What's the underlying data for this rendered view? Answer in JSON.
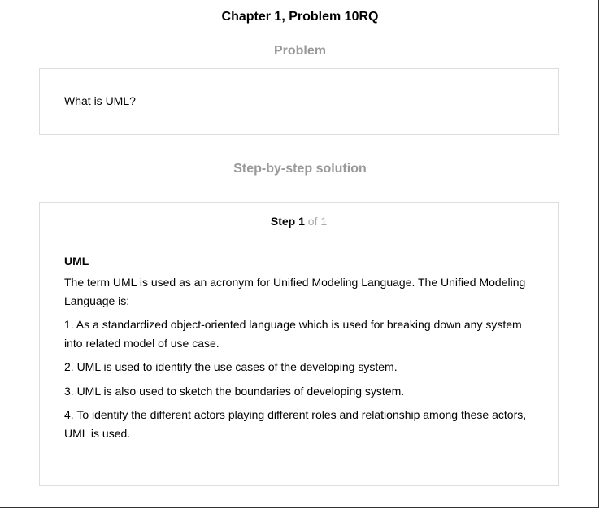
{
  "header": {
    "chapter_title": "Chapter 1, Problem 10RQ"
  },
  "problem": {
    "heading": "Problem",
    "text": "What is UML?"
  },
  "solution": {
    "heading": "Step-by-step solution",
    "step": {
      "label": "Step",
      "number": "1",
      "of_total": "of 1"
    },
    "subheading": "UML",
    "paragraphs": [
      "The term UML is used as an acronym for Unified Modeling Language. The Unified Modeling Language is:",
      "1. As a standardized object-oriented language which is used for breaking down any system into related model of use case.",
      "2. UML is used to identify the use cases of the developing system.",
      "3. UML is also used to sketch the boundaries of developing system.",
      "4. To identify the different actors playing different roles and relationship among these actors, UML is used."
    ]
  },
  "colors": {
    "section_heading": "#999999",
    "card_border": "#dddddd",
    "step_of": "#aaaaaa"
  }
}
